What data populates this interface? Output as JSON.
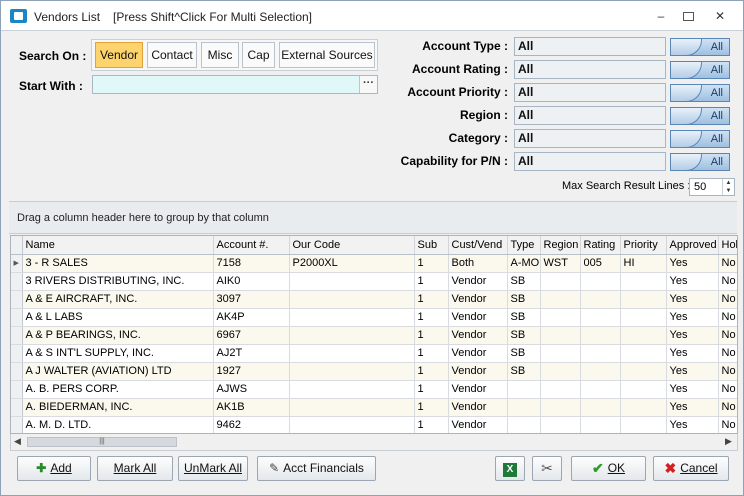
{
  "window": {
    "title": "Vendors List",
    "subtitle": "[Press Shift^Click For Multi Selection]",
    "minimize": "▭",
    "restore": "⧉",
    "close": "✕"
  },
  "search": {
    "search_on_label": "Search On :",
    "start_with_label": "Start With :",
    "start_with_value": "",
    "ellipsis": "···",
    "options": [
      "Vendor",
      "Contact",
      "Misc",
      "Cap",
      "External Sources"
    ],
    "selected": "Vendor"
  },
  "filters": [
    {
      "label": "Account Type :",
      "value": "All",
      "button": "All"
    },
    {
      "label": "Account Rating :",
      "value": "All",
      "button": "All"
    },
    {
      "label": "Account Priority :",
      "value": "All",
      "button": "All"
    },
    {
      "label": "Region :",
      "value": "All",
      "button": "All"
    },
    {
      "label": "Category :",
      "value": "All",
      "button": "All"
    },
    {
      "label": "Capability for P/N :",
      "value": "All",
      "button": "All"
    }
  ],
  "max_results": {
    "label": "Max Search Result Lines :",
    "value": "50"
  },
  "group_bar": {
    "text": "Drag a column header here to group by that column"
  },
  "grid": {
    "columns": [
      "Name",
      "Account #.",
      "Our Code",
      "Sub",
      "Cust/Vend",
      "Type",
      "Region",
      "Rating",
      "Priority",
      "Approved",
      "Hold"
    ],
    "rows": [
      [
        "3 - R SALES",
        "7158",
        "P2000XL",
        "1",
        "Both",
        "A-MOI",
        "WST",
        "005",
        "HI",
        "Yes",
        "No"
      ],
      [
        "3 RIVERS DISTRIBUTING, INC.",
        "AIK0",
        "",
        "1",
        "Vendor",
        "SB",
        "",
        "",
        "",
        "Yes",
        "No"
      ],
      [
        "A & E AIRCRAFT, INC.",
        "3097",
        "",
        "1",
        "Vendor",
        "SB",
        "",
        "",
        "",
        "Yes",
        "No"
      ],
      [
        "A & L LABS",
        "AK4P",
        "",
        "1",
        "Vendor",
        "SB",
        "",
        "",
        "",
        "Yes",
        "No"
      ],
      [
        "A & P BEARINGS, INC.",
        "6967",
        "",
        "1",
        "Vendor",
        "SB",
        "",
        "",
        "",
        "Yes",
        "No"
      ],
      [
        "A & S INT'L SUPPLY, INC.",
        "AJ2T",
        "",
        "1",
        "Vendor",
        "SB",
        "",
        "",
        "",
        "Yes",
        "No"
      ],
      [
        "A J WALTER (AVIATION) LTD",
        "1927",
        "",
        "1",
        "Vendor",
        "SB",
        "",
        "",
        "",
        "Yes",
        "No"
      ],
      [
        "A. B. PERS CORP.",
        "AJWS",
        "",
        "1",
        "Vendor",
        "",
        "",
        "",
        "",
        "Yes",
        "No"
      ],
      [
        "A. BIEDERMAN, INC.",
        "AK1B",
        "",
        "1",
        "Vendor",
        "",
        "",
        "",
        "",
        "Yes",
        "No"
      ],
      [
        "A. M. D. LTD.",
        "9462",
        "",
        "1",
        "Vendor",
        "",
        "",
        "",
        "",
        "Yes",
        "No"
      ]
    ]
  },
  "buttons": {
    "add": "Add",
    "mark_all": "Mark All",
    "unmark_all": "UnMark All",
    "acct_financials": "Acct Financials",
    "ok": "OK",
    "cancel": "Cancel"
  },
  "colors": {
    "accent": "#fcd36c",
    "start_input_bg": "#e0f9f8",
    "row_alt": "#fbf8ee",
    "ok_check": "#2e9a2e",
    "cancel_x": "#d42020"
  },
  "icons": [
    "app-icon",
    "add-icon",
    "acct-financials-icon",
    "excel-icon",
    "tools-icon",
    "ok-check-icon",
    "cancel-x-icon"
  ]
}
